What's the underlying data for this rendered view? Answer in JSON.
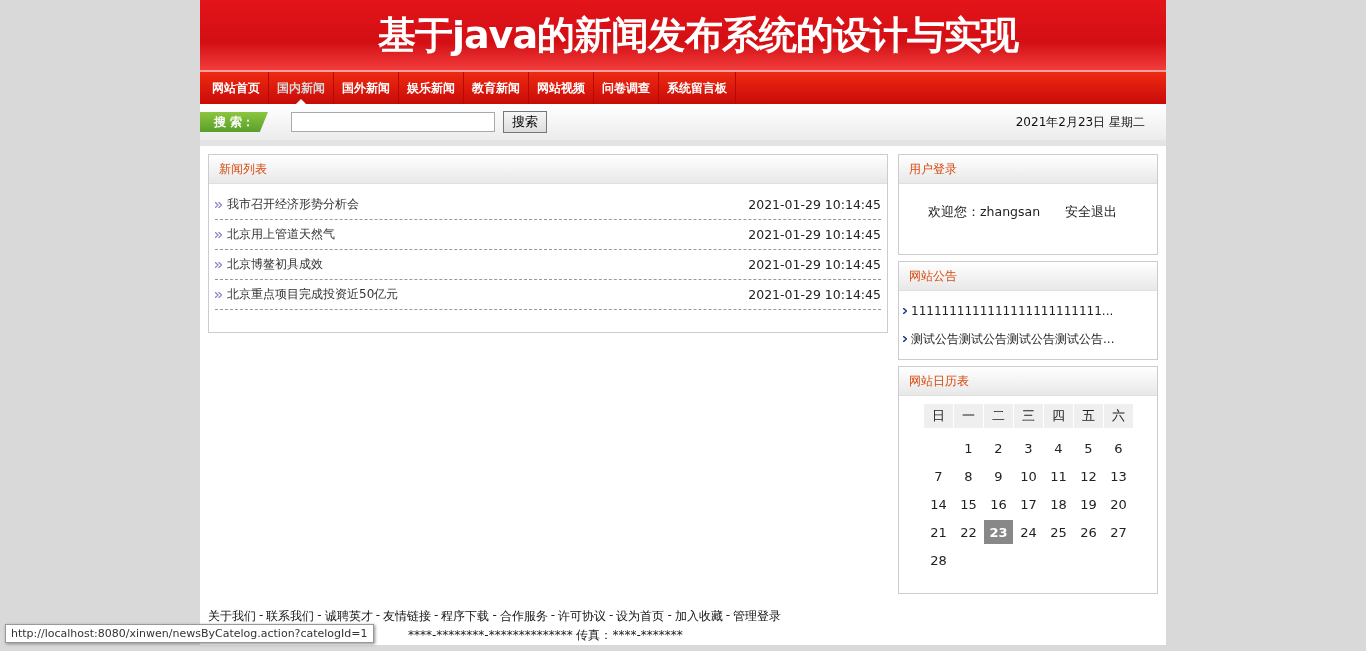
{
  "header": {
    "title": "基于java的新闻发布系统的设计与实现"
  },
  "nav": [
    {
      "label": "网站首页",
      "selected": false
    },
    {
      "label": "国内新闻",
      "selected": true
    },
    {
      "label": "国外新闻",
      "selected": false
    },
    {
      "label": "娱乐新闻",
      "selected": false
    },
    {
      "label": "教育新闻",
      "selected": false
    },
    {
      "label": "网站视频",
      "selected": false
    },
    {
      "label": "问卷调查",
      "selected": false
    },
    {
      "label": "系统留言板",
      "selected": false
    }
  ],
  "search": {
    "label": "搜 索：",
    "button": "搜索",
    "date": "2021年2月23日 星期二"
  },
  "news": {
    "title": "新闻列表",
    "items": [
      {
        "title": "我市召开经济形势分析会",
        "time": "2021-01-29 10:14:45"
      },
      {
        "title": "北京用上管道天然气",
        "time": "2021-01-29 10:14:45"
      },
      {
        "title": "北京博鳌初具成效",
        "time": "2021-01-29 10:14:45"
      },
      {
        "title": "北京重点项目完成投资近50亿元",
        "time": "2021-01-29 10:14:45"
      }
    ]
  },
  "login": {
    "title": "用户登录",
    "welcome": "欢迎您：zhangsan",
    "logout": "安全退出"
  },
  "notices": {
    "title": "网站公告",
    "items": [
      "1111111111111111111111111...",
      "测试公告测试公告测试公告测试公告..."
    ]
  },
  "calendar": {
    "title": "网站日历表",
    "weekdays": [
      "日",
      "一",
      "二",
      "三",
      "四",
      "五",
      "六"
    ],
    "weeks": [
      [
        {
          "kind": "blank"
        },
        {
          "kind": "day",
          "day": "1",
          "selected": false
        },
        {
          "kind": "day",
          "day": "2",
          "selected": false
        },
        {
          "kind": "day",
          "day": "3",
          "selected": false
        },
        {
          "kind": "day",
          "day": "4",
          "selected": false
        },
        {
          "kind": "day",
          "day": "5",
          "selected": false
        },
        {
          "kind": "day",
          "day": "6",
          "selected": false
        }
      ],
      [
        {
          "kind": "day",
          "day": "7",
          "selected": false
        },
        {
          "kind": "day",
          "day": "8",
          "selected": false
        },
        {
          "kind": "day",
          "day": "9",
          "selected": false
        },
        {
          "kind": "day",
          "day": "10",
          "selected": false
        },
        {
          "kind": "day",
          "day": "11",
          "selected": false
        },
        {
          "kind": "day",
          "day": "12",
          "selected": false
        },
        {
          "kind": "day",
          "day": "13",
          "selected": false
        }
      ],
      [
        {
          "kind": "day",
          "day": "14",
          "selected": false
        },
        {
          "kind": "day",
          "day": "15",
          "selected": false
        },
        {
          "kind": "day",
          "day": "16",
          "selected": false
        },
        {
          "kind": "day",
          "day": "17",
          "selected": false
        },
        {
          "kind": "day",
          "day": "18",
          "selected": false
        },
        {
          "kind": "day",
          "day": "19",
          "selected": false
        },
        {
          "kind": "day",
          "day": "20",
          "selected": false
        }
      ],
      [
        {
          "kind": "day",
          "day": "21",
          "selected": false
        },
        {
          "kind": "day",
          "day": "22",
          "selected": false
        },
        {
          "kind": "day",
          "day": "23",
          "selected": true
        },
        {
          "kind": "day",
          "day": "24",
          "selected": false
        },
        {
          "kind": "day",
          "day": "25",
          "selected": false
        },
        {
          "kind": "day",
          "day": "26",
          "selected": false
        },
        {
          "kind": "day",
          "day": "27",
          "selected": false
        }
      ],
      [
        {
          "kind": "day",
          "day": "28",
          "selected": false
        }
      ]
    ]
  },
  "footer": {
    "separator": "-",
    "links": [
      "关于我们",
      "联系我们",
      "诚聘英才",
      "友情链接",
      "程序下载",
      "合作服务",
      "许可协议",
      "设为首页",
      "加入收藏",
      "管理登录"
    ],
    "contact": "****-********-************** 传真：****-*******"
  },
  "status_url": "http://localhost:8080/xinwen/newsByCatelog.action?catelogId=1"
}
